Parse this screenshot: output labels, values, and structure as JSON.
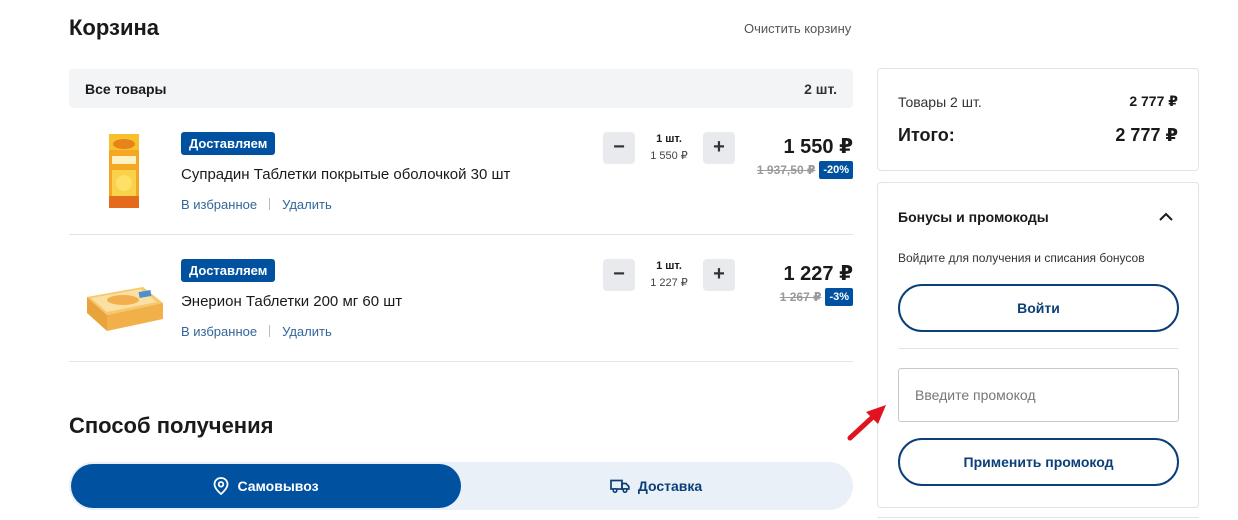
{
  "cart": {
    "title": "Корзина",
    "clear_label": "Очистить корзину",
    "all_items_label": "Все товары",
    "all_items_count": "2 шт."
  },
  "items": [
    {
      "badge": "Доставляем",
      "name": "Супрадин Таблетки покрытые оболочкой 30 шт",
      "fav_label": "В избранное",
      "delete_label": "Удалить",
      "qty_count": "1 шт.",
      "qty_unit_price": "1 550 ₽",
      "price": "1 550 ₽",
      "old_price": "1 937,50 ₽",
      "discount": "-20%",
      "image_icon": "supradin-pack-image"
    },
    {
      "badge": "Доставляем",
      "name": "Энерион Таблетки 200 мг 60 шт",
      "fav_label": "В избранное",
      "delete_label": "Удалить",
      "qty_count": "1 шт.",
      "qty_unit_price": "1 227 ₽",
      "price": "1 227 ₽",
      "old_price": "1 267 ₽",
      "discount": "-3%",
      "image_icon": "enerion-pack-image"
    }
  ],
  "delivery": {
    "title": "Способ получения",
    "pickup_label": "Самовывоз",
    "delivery_label": "Доставка",
    "selected": "pickup"
  },
  "summary": {
    "items_label": "Товары 2 шт.",
    "items_value": "2 777 ₽",
    "total_label": "Итого:",
    "total_value": "2 777 ₽"
  },
  "bonus": {
    "title": "Бонусы и промокоды",
    "hint": "Войдите для получения и списания бонусов",
    "login_label": "Войти",
    "promo_placeholder": "Введите промокод",
    "promo_value": "",
    "apply_label": "Применить промокод"
  },
  "colors": {
    "brand_blue": "#0052a0",
    "dark_blue": "#0b3f77",
    "annotation_red": "#e0141e"
  }
}
